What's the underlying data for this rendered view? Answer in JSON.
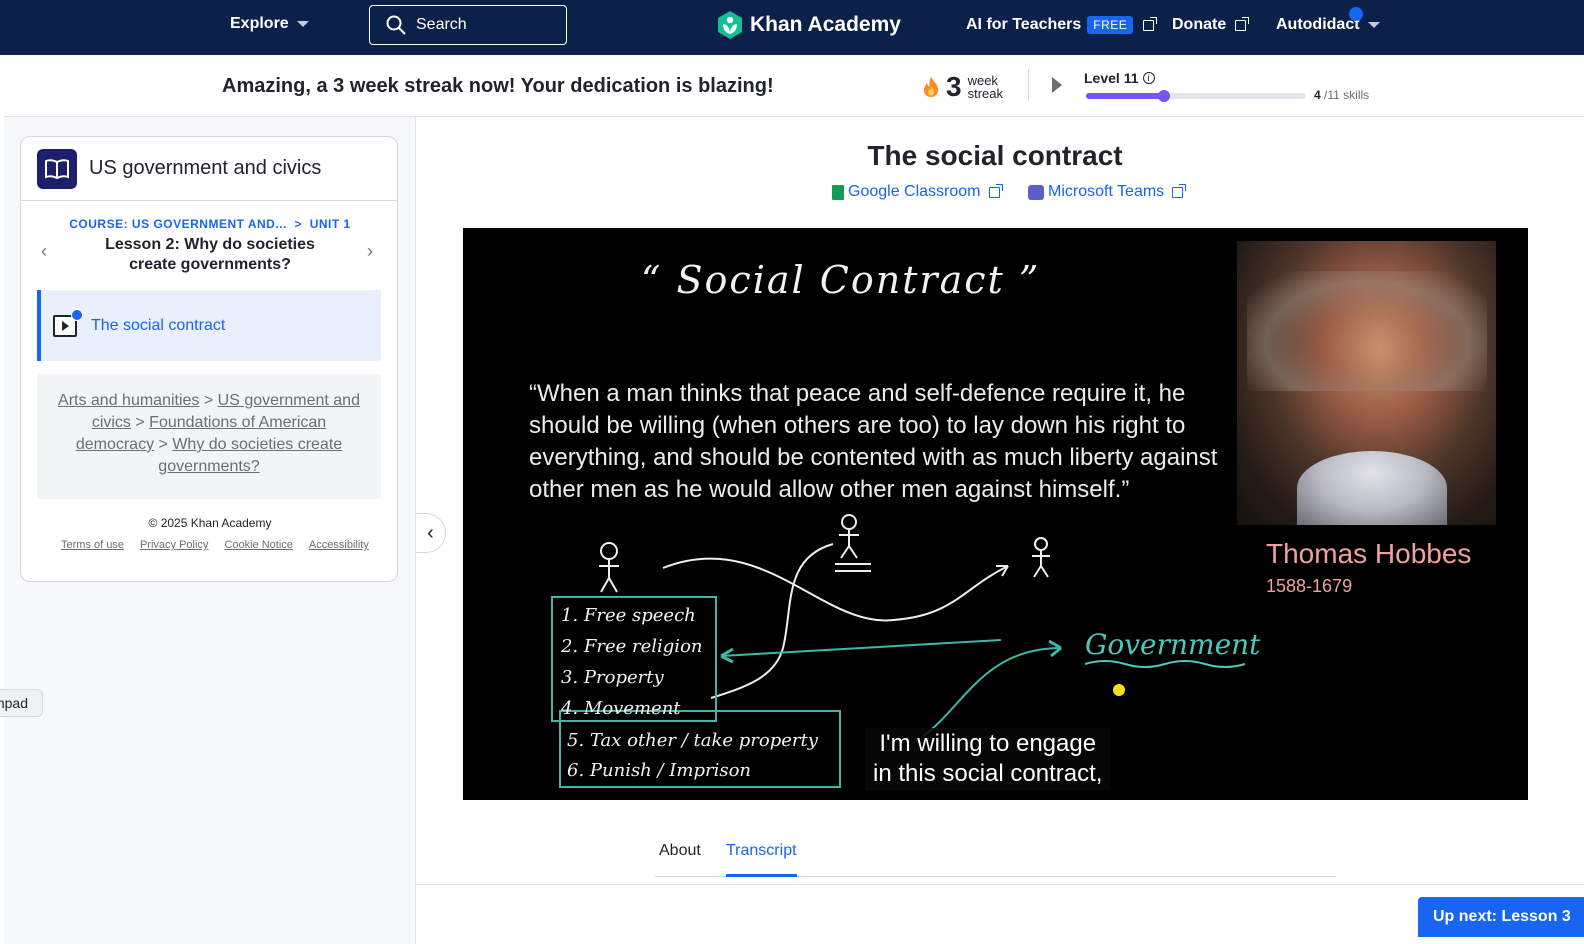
{
  "nav": {
    "explore": "Explore",
    "search_label": "Search",
    "brand": "Khan Academy",
    "ai_teachers": "AI for Teachers",
    "free_badge": "FREE",
    "donate": "Donate",
    "user": "Autodidact"
  },
  "streak": {
    "message": "Amazing, a 3 week streak now! Your dedication is blazing!",
    "count": "3",
    "unit_line1": "week",
    "unit_line2": "streak",
    "level": "Level 11",
    "skills_done": "4",
    "skills_total": "/11 skills",
    "progress_fraction": 0.36
  },
  "sidebar": {
    "course_title": "US government and civics",
    "course_crumb": "COURSE: US GOVERNMENT AND...",
    "unit_crumb": "UNIT 1",
    "lesson_title": "Lesson 2: Why do societies create governments?",
    "current_item": "The social contract",
    "breadcrumbs": [
      "Arts and humanities",
      "US government and civics",
      "Foundations of American democracy",
      "Why do societies create governments?"
    ],
    "copyright": "© 2025 Khan Academy",
    "footer_links": [
      "Terms of use",
      "Privacy Policy",
      "Cookie Notice",
      "Accessibility"
    ],
    "notepad_tab": "npad"
  },
  "main": {
    "title": "The social contract",
    "share_google": "Google Classroom",
    "share_teams": "Microsoft Teams",
    "tabs": [
      "About",
      "Transcript"
    ],
    "active_tab": "Transcript",
    "up_next": "Up next: Lesson 3"
  },
  "video": {
    "board_title": "“ Social  Contract ”",
    "quote": "“When a man thinks that peace and self-defence require it, he should be willing (when others are too) to lay down his right to everything, and should be contented with as much liberty against other men as he would allow other men against himself.”",
    "portrait_name": "Thomas Hobbes",
    "portrait_dates": "1588-1679",
    "list_rights": [
      "1. Free  speech",
      "2. Free  religion",
      "3. Property",
      "4. Movement"
    ],
    "list_gov": [
      "5. Tax other / take property",
      "6. Punish / Imprison"
    ],
    "government_label": "Government",
    "caption_line1": "I'm willing to engage",
    "caption_line2": "in this social contract,"
  },
  "colors": {
    "nav_bg": "#0b2149",
    "accent": "#1865f2",
    "progress": "#7854f7",
    "chalk_teal": "#3fb6a8",
    "hobbes_pink": "#f0a0a0"
  }
}
